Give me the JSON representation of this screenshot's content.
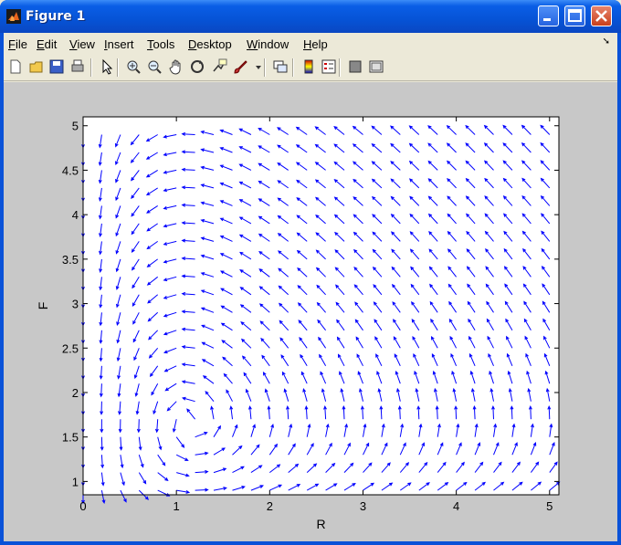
{
  "window": {
    "title": "Figure 1"
  },
  "menu": {
    "items": [
      {
        "label": "File",
        "u": "F",
        "rest": "ile"
      },
      {
        "label": "Edit",
        "u": "E",
        "rest": "dit"
      },
      {
        "label": "View",
        "u": "V",
        "rest": "iew"
      },
      {
        "label": "Insert",
        "u": "I",
        "rest": "nsert"
      },
      {
        "label": "Tools",
        "u": "T",
        "rest": "ools"
      },
      {
        "label": "Desktop",
        "u": "D",
        "rest": "esktop"
      },
      {
        "label": "Window",
        "u": "W",
        "rest": "indow"
      },
      {
        "label": "Help",
        "u": "H",
        "rest": "elp"
      }
    ]
  },
  "toolbar": {
    "icons": [
      "new-figure-icon",
      "open-file-icon",
      "save-icon",
      "print-icon",
      "pointer-icon",
      "zoom-in-icon",
      "zoom-out-icon",
      "pan-icon",
      "rotate-3d-icon",
      "data-cursor-icon",
      "brush-icon",
      "brush-dropdown-icon",
      "link-plot-icon",
      "colorbar-icon",
      "legend-icon",
      "hide-plot-tools-icon",
      "show-plot-tools-icon"
    ]
  },
  "chart_data": {
    "type": "quiver",
    "title": "",
    "xlabel": "R",
    "ylabel": "F",
    "xlim": [
      0,
      5.1
    ],
    "ylim": [
      0.85,
      5.1
    ],
    "xticks": [
      "0",
      "1",
      "2",
      "3",
      "4",
      "5"
    ],
    "yticks": [
      "1",
      "1.5",
      "2",
      "2.5",
      "3",
      "3.5",
      "4",
      "4.5",
      "5"
    ],
    "grid": "off",
    "color": "#0000ff",
    "x_range": [
      0,
      5.0
    ],
    "y_range": [
      0.9,
      5.0
    ],
    "grid_step": 0.2,
    "equilibrium": [
      1.15,
      1.65
    ]
  }
}
